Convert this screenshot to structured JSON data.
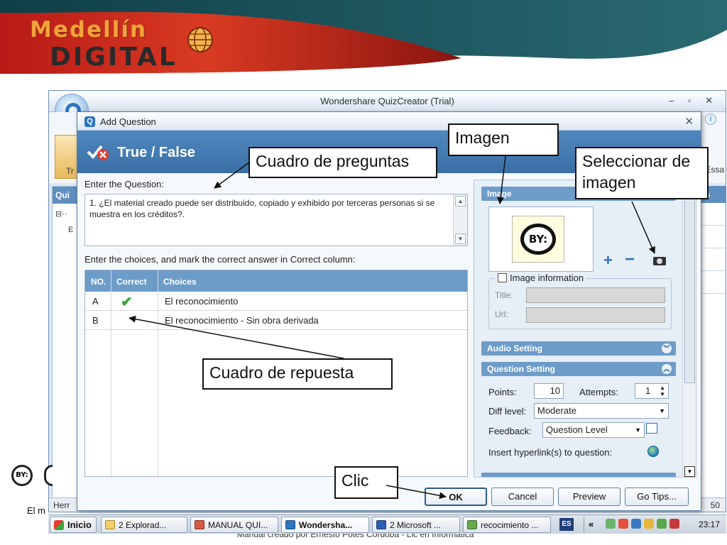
{
  "brand": {
    "top": "Medellín",
    "bottom": "DIGITAL"
  },
  "app": {
    "window_title": "Wondershare QuizCreator (Trial)",
    "window_controls": "– ▫ ✕",
    "ribbon_left": "Tr",
    "ribbon_right": "Essa",
    "side_header": "Qui",
    "side_tree": [
      "⊟··",
      "E"
    ],
    "right_header": "rs",
    "status_left": "Herr",
    "status_right": "50"
  },
  "dialog": {
    "title": "Add Question",
    "close": "✕",
    "help": "i",
    "header_title": "True / False",
    "question_label": "Enter the Question:",
    "question_text": "1. ¿El material creado puede ser distribuido, copiado y exhibido por terceras personas si se muestra en los créditos?.",
    "choices_label": "Enter the choices, and mark the correct answer in Correct column:",
    "columns": [
      "NO.",
      "Correct",
      "Choices"
    ],
    "rows": [
      {
        "no": "A",
        "correct": true,
        "choice": "El reconocimiento"
      },
      {
        "no": "B",
        "correct": false,
        "choice": "El reconocimiento - Sin obra derivada"
      }
    ],
    "check_mark": "✔"
  },
  "side": {
    "image_header": "Image",
    "badge_text": "BY:",
    "image_info_label": "Image information",
    "title_label": "Title:",
    "url_label": "Url:",
    "audio_header": "Audio Setting",
    "question_setting_header": "Question Setting",
    "points_label": "Points:",
    "points_value": "10",
    "attempts_label": "Attempts:",
    "attempts_value": "1",
    "diff_label": "Diff level:",
    "diff_value": "Moderate",
    "feedback_label": "Feedback:",
    "feedback_value": "Question Level",
    "hyperlink_label": "Insert hyperlink(s) to question:"
  },
  "buttons": {
    "ok": "OK",
    "cancel": "Cancel",
    "preview": "Preview",
    "go_tips": "Go Tips..."
  },
  "callouts": {
    "imagen": "Imagen",
    "cuadro_preguntas": "Cuadro de preguntas",
    "seleccionar": "Seleccionar de imagen",
    "cuadro_respuesta": "Cuadro de repuesta",
    "clic": "Clic"
  },
  "slide": {
    "footer_left": "El m",
    "footer_center": "Manual creado por Ernesto Potes Córdoba - Lic en Informatica",
    "cc_badge": "BY:"
  },
  "taskbar": {
    "start": "Inicio",
    "items": [
      "2 Explorad...",
      "MANUAL QUI...",
      "Wondersha...",
      "2 Microsoft ...",
      "recocimiento ..."
    ],
    "lang": "ES",
    "chevrons": "«",
    "clock": "23:17"
  },
  "colors": {
    "banner_red": "#c2201b",
    "banner_teal": "#1d5560",
    "dialog_header": "#4f88bf",
    "table_header": "#6d9cc8",
    "check_green": "#3aa63a"
  }
}
